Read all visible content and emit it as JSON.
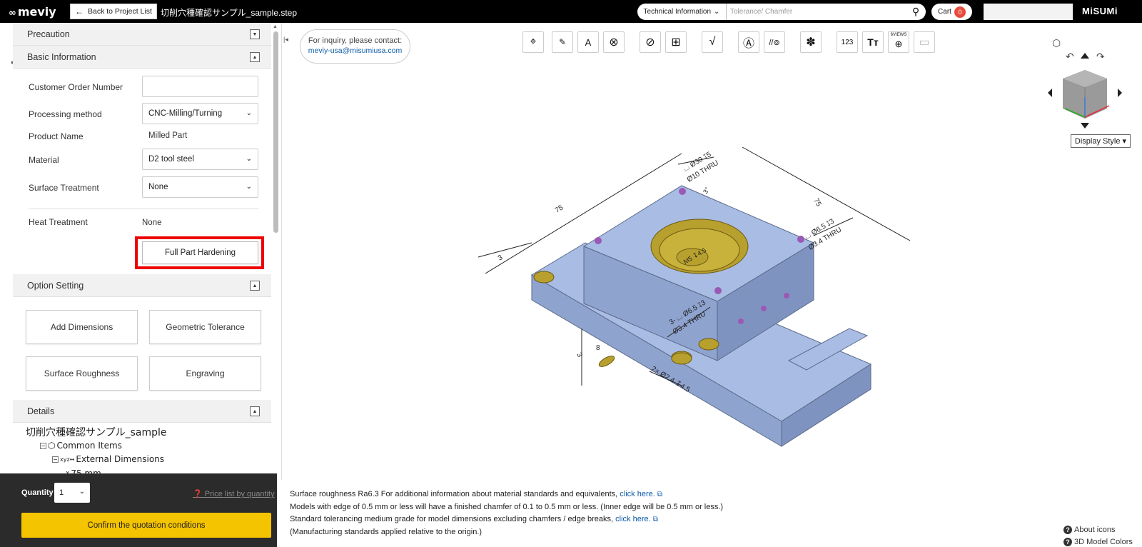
{
  "topbar": {
    "logo": "meviy",
    "back_label": "Back to Project List",
    "filename": "切削穴種確認サンプル_sample.step",
    "search_category": "Technical Information",
    "search_placeholder": "Tolerance/ Chamfer",
    "cart_label": "Cart",
    "cart_count": "0",
    "brand": "MiSUMi"
  },
  "sections": {
    "precaution": "Precaution",
    "basic_info": "Basic Information",
    "option_setting": "Option Setting",
    "details": "Details"
  },
  "basic": {
    "customer_order_label": "Customer Order Number",
    "customer_order_value": "",
    "processing_label": "Processing method",
    "processing_value": "CNC-Milling/Turning",
    "product_name_label": "Product Name",
    "product_name_value": "Milled Part",
    "material_label": "Material",
    "material_value": "D2 tool steel",
    "surface_label": "Surface Treatment",
    "surface_value": "None",
    "heat_label": "Heat Treatment",
    "heat_value": "None",
    "hardening_button": "Full Part Hardening"
  },
  "options": {
    "add_dimensions": "Add Dimensions",
    "geometric_tolerance": "Geometric Tolerance",
    "surface_roughness": "Surface Roughness",
    "engraving": "Engraving"
  },
  "details": {
    "tree_title": "切削穴種確認サンプル_sample",
    "common_items": "Common Items",
    "external_dimensions": "External Dimensions",
    "x_value": "75 mm"
  },
  "quantity": {
    "label": "Quantity",
    "value": "1",
    "price_link": "Price list by quantity",
    "confirm": "Confirm the quotation conditions"
  },
  "inquiry": {
    "line1": "For inquiry, please contact:",
    "email": "meviy-usa@misumiusa.com"
  },
  "viewer": {
    "display_style": "Display Style",
    "toolbar_icons": [
      "origin-icon",
      "measure-pen-icon",
      "text-dim-icon",
      "clear-dim-icon",
      "hide-dim-icon",
      "hole-table-icon",
      "roughness-icon",
      "annotation-icon",
      "tolerance-icon",
      "paint-icon",
      "ruler-icon",
      "text-size-icon",
      "six-views-icon",
      "document-icon"
    ],
    "views_label": "6VIEWS",
    "dimensions": {
      "d75a": "75",
      "d75b": "75",
      "d3a": "3",
      "hole_top": "⌴ Ø30 ↧5",
      "hole_top2": "Ø10 THRU",
      "thread": "M5 ↧4.5",
      "right_cb1": "⌴ Ø6.5 ↧3",
      "right_cb2": "Ø3.4 THRU",
      "front_cb1": "3- ⌴ Ø6.5 ↧3",
      "front_cb2": "Ø3.4 THRU",
      "slot_8": "8",
      "slot_3": "3",
      "drill": "2× Ø2.4 ↧4.5",
      "angle": "3°"
    }
  },
  "notes": {
    "line1": "Surface roughness Ra6.3    For additional information about material standards and equivalents,",
    "link1": "click here.",
    "line2": "Models with edge of 0.5 mm or less will have a finished chamfer of 0.1 to 0.5 mm or less. (Inner edge will be 0.5 mm or less.)",
    "line3": "Standard tolerancing medium grade for model dimensions excluding chamfers / edge breaks,",
    "link3": "click here.",
    "line4": "(Manufacturing standards applied relative to the origin.)"
  },
  "help": {
    "about_icons": "About icons",
    "model_colors": "3D Model Colors"
  },
  "colors": {
    "part_fill": "#a9bce3",
    "hole_fill": "#b8a02e",
    "confirm": "#f5c400",
    "highlight": "#ee0000"
  }
}
